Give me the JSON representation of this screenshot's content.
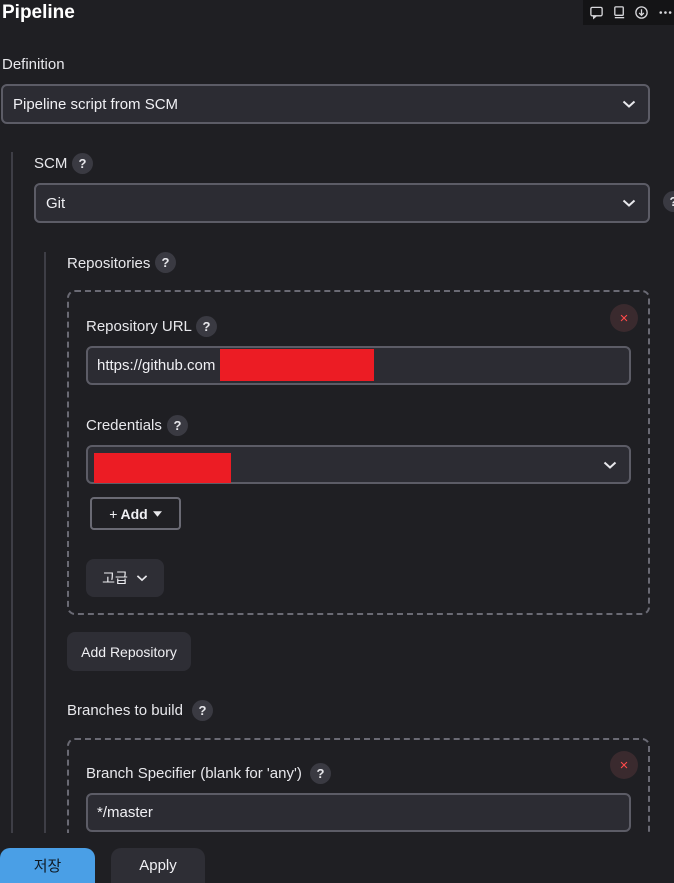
{
  "header": {
    "title": "Pipeline"
  },
  "toolbar": {
    "icons": [
      "comment-icon",
      "clipboard-icon",
      "download-icon",
      "more-icon"
    ]
  },
  "definition": {
    "label": "Definition",
    "selected": "Pipeline script from SCM"
  },
  "scm": {
    "label": "SCM",
    "help": "?",
    "selected": "Git",
    "side_help": "?"
  },
  "repositories": {
    "label": "Repositories",
    "help": "?",
    "close": "×",
    "url": {
      "label": "Repository URL",
      "help": "?",
      "value": "https://github.com"
    },
    "credentials": {
      "label": "Credentials",
      "help": "?"
    },
    "add_button": "Add",
    "advanced_button": "고급"
  },
  "add_repository_button": "Add Repository",
  "branches": {
    "label": "Branches to build",
    "help": "?",
    "close": "×",
    "specifier": {
      "label": "Branch Specifier (blank for 'any')",
      "help": "?",
      "value": "*/master"
    }
  },
  "footer": {
    "save": "저장",
    "apply": "Apply"
  },
  "colors": {
    "accent": "#4a9fe6",
    "danger": "#ff4a4a",
    "redaction": "#ec1c24"
  }
}
